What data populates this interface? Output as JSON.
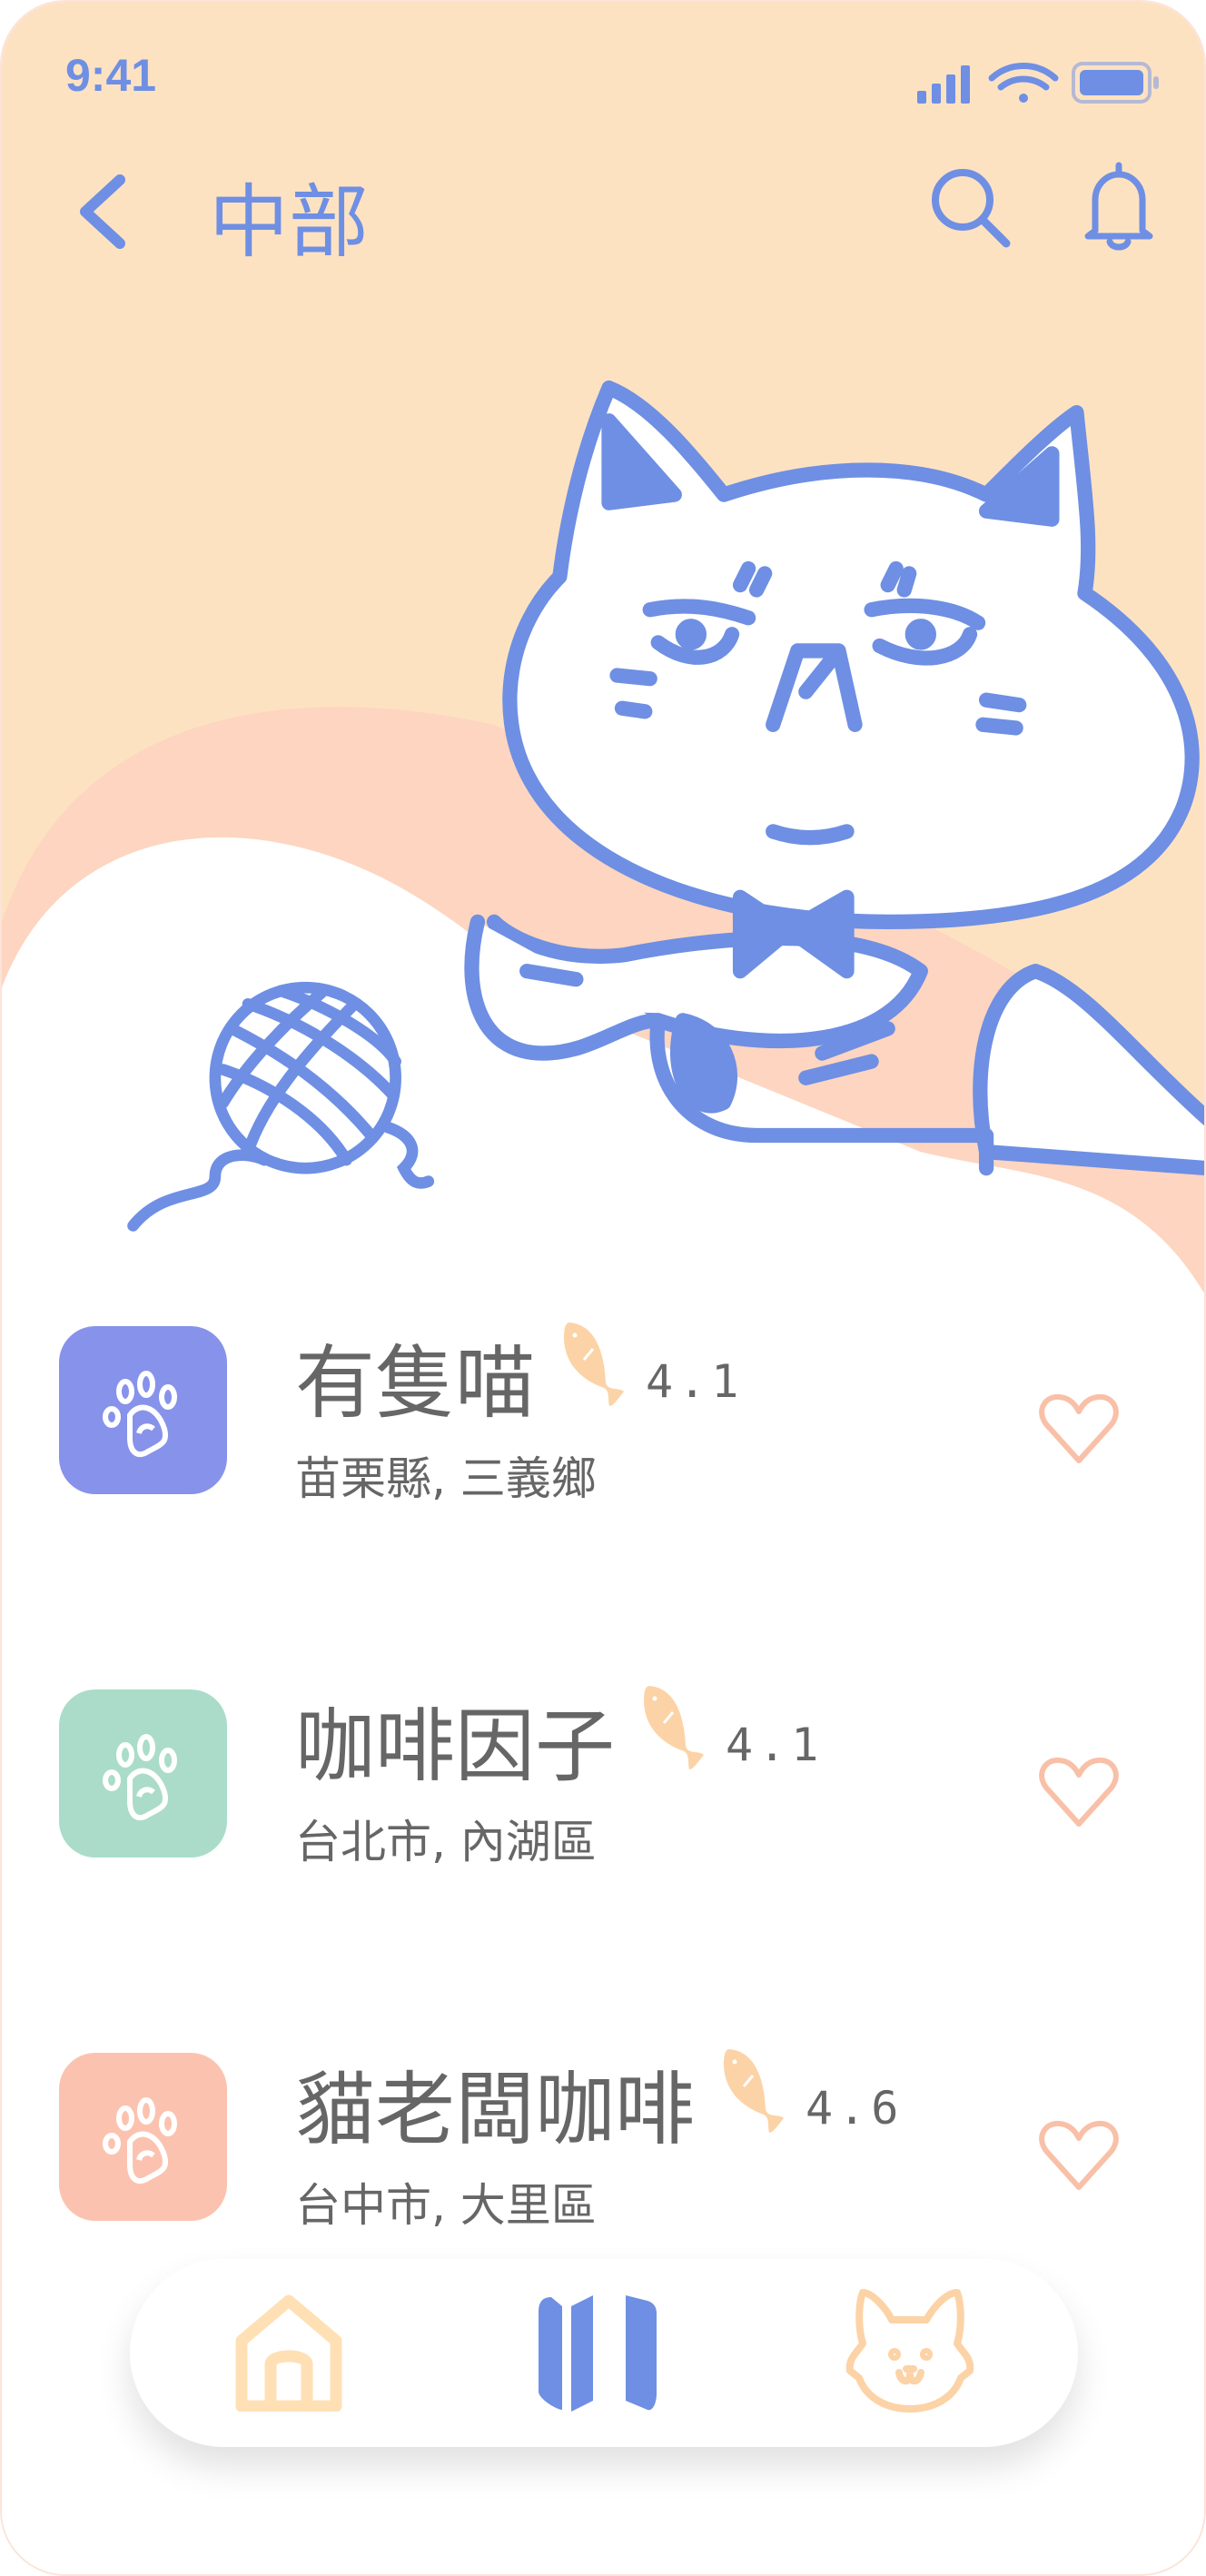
{
  "status_bar": {
    "time": "9:41",
    "icons": [
      "cellular-signal-icon",
      "wifi-icon",
      "battery-icon"
    ]
  },
  "header": {
    "title": "中部",
    "back_icon": "chevron-left-icon",
    "search_icon": "search-icon",
    "notification_icon": "bell-icon"
  },
  "colors": {
    "accent": "#6E8FE3",
    "header_bg": "#FDE2C2",
    "wave": "#FDD5C0",
    "text": "#666666",
    "heart": "#F9C0A8",
    "fish": "#FCD3A6"
  },
  "cafes": [
    {
      "name": "有隻喵",
      "rating": "4.1",
      "location": "苗栗縣, 三義鄉",
      "color": "#8792EA",
      "icon": "paw-icon"
    },
    {
      "name": "咖啡因子",
      "rating": "4.1",
      "location": "台北市, 內湖區",
      "color": "#AADCC9",
      "icon": "paw-icon"
    },
    {
      "name": "貓老闆咖啡",
      "rating": "4.6",
      "location": "台中市, 大里區",
      "color": "#FBC3AF",
      "icon": "paw-icon"
    }
  ],
  "bottom_nav": [
    {
      "icon": "home-icon",
      "active": false
    },
    {
      "icon": "map-icon",
      "active": true
    },
    {
      "icon": "cat-icon",
      "active": false
    }
  ]
}
